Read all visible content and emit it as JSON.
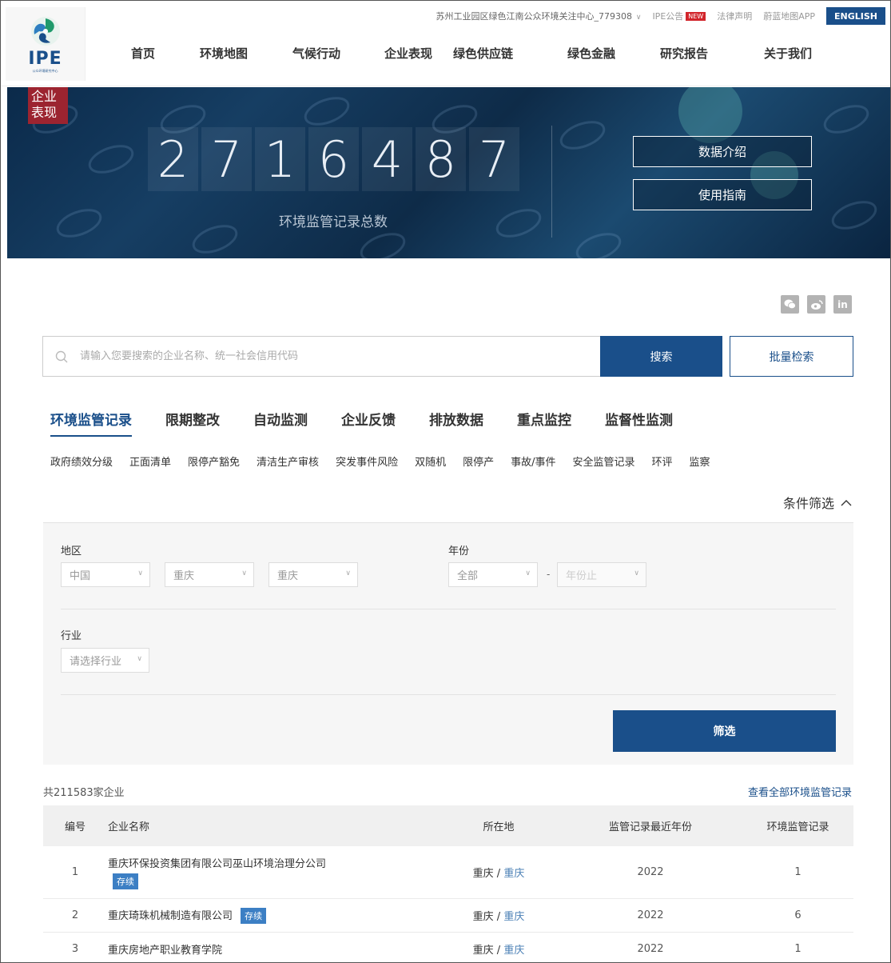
{
  "header": {
    "logo_text": "IPE",
    "logo_sub": "公众环境研究中心",
    "topbar": {
      "org": "苏州工业园区绿色江南公众环境关注中心_779308",
      "notice": "IPE公告",
      "new_badge": "NEW",
      "legal": "法律声明",
      "app": "蔚蓝地图APP",
      "english": "ENGLISH"
    },
    "nav": [
      "首页",
      "环境地图",
      "气候行动",
      "企业表现",
      "绿色供应链",
      "绿色金融",
      "研究报告",
      "关于我们"
    ]
  },
  "banner": {
    "tag": "企业\n表现",
    "digits": [
      "2",
      "7",
      "1",
      "6",
      "4",
      "8",
      "7"
    ],
    "label": "环境监管记录总数",
    "btn_intro": "数据介绍",
    "btn_guide": "使用指南"
  },
  "social": [
    "wechat-icon",
    "weibo-icon",
    "linkedin-icon"
  ],
  "search": {
    "placeholder": "请输入您要搜索的企业名称、统一社会信用代码",
    "button": "搜索",
    "batch": "批量检索"
  },
  "tabs": [
    "环境监管记录",
    "限期整改",
    "自动监测",
    "企业反馈",
    "排放数据",
    "重点监控",
    "监督性监测"
  ],
  "subtabs": [
    "政府绩效分级",
    "正面清单",
    "限停产豁免",
    "清洁生产审核",
    "突发事件风险",
    "双随机",
    "限停产",
    "事故/事件",
    "安全监管记录",
    "环评",
    "监察"
  ],
  "filter": {
    "toggle": "条件筛选",
    "region_label": "地区",
    "region": [
      "中国",
      "重庆",
      "重庆"
    ],
    "year_label": "年份",
    "year_from": "全部",
    "year_to": "年份止",
    "industry_label": "行业",
    "industry": "请选择行业",
    "button": "筛选"
  },
  "results": {
    "count": "共211583家企业",
    "view_all": "查看全部环境监管记录",
    "headers": [
      "编号",
      "企业名称",
      "所在地",
      "监管记录最近年份",
      "环境监管记录"
    ],
    "rows": [
      {
        "no": "1",
        "name": "重庆环保投资集团有限公司巫山环境治理分公司",
        "badge": "存续",
        "prov": "重庆",
        "city": "重庆",
        "year": "2022",
        "records": "1"
      },
      {
        "no": "2",
        "name": "重庆琦珠机械制造有限公司",
        "badge": "存续",
        "prov": "重庆",
        "city": "重庆",
        "year": "2022",
        "records": "6"
      },
      {
        "no": "3",
        "name": "重庆房地产职业教育学院",
        "badge": "",
        "prov": "重庆",
        "city": "重庆",
        "year": "2022",
        "records": "1"
      }
    ]
  }
}
